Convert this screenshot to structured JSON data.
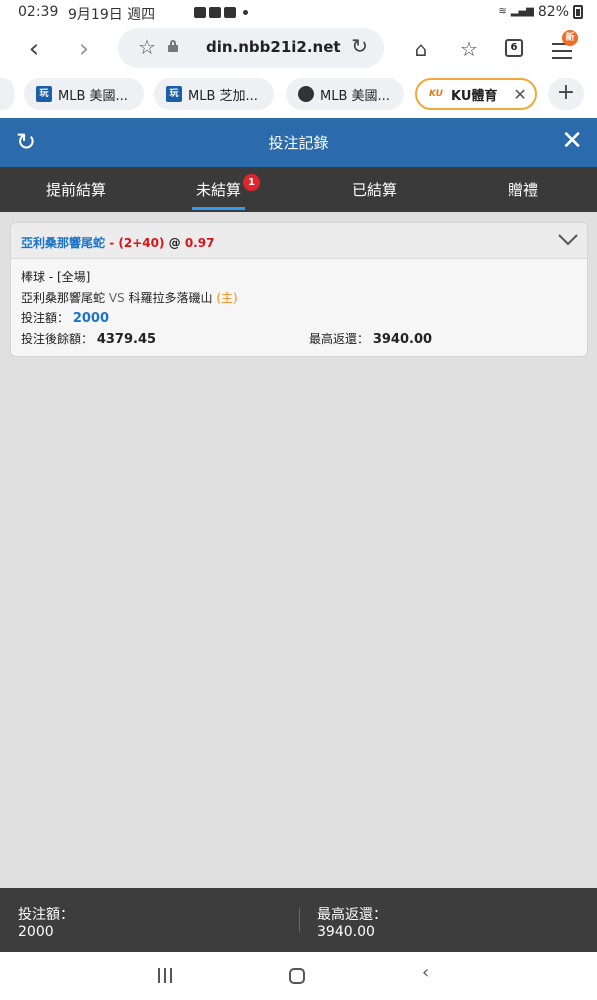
{
  "status": {
    "time": "02:39",
    "date": "9月19日 週四",
    "battery": "82%"
  },
  "browser": {
    "url": "din.nbb21i2.net",
    "tab_count": "6",
    "menu_badge": "新",
    "tabs": [
      {
        "label": "MLB 美國...",
        "icon": "sports-site-icon"
      },
      {
        "label": "MLB 芝加...",
        "icon": "sports-site-icon"
      },
      {
        "label": "MLB 美國...",
        "icon": "helmet-icon"
      },
      {
        "label": "KU體育",
        "icon": "ku-logo-icon"
      }
    ],
    "ku_badge": "KU"
  },
  "app": {
    "title": "投注記錄",
    "tabs": [
      {
        "label": "提前結算"
      },
      {
        "label": "未結算"
      },
      {
        "label": "已結算"
      },
      {
        "label": "贈禮"
      }
    ],
    "unsettled_count": "1"
  },
  "bet": {
    "team": "亞利桑那響尾蛇",
    "handicap": "- (2+40)",
    "at": "@",
    "odds": "0.97",
    "sport_line": "棒球 - [全場]",
    "home_team": "亞利桑那響尾蛇",
    "vs": "VS",
    "away_team": "科羅拉多落磯山",
    "home_tag": "(主)",
    "stake_label": "投注額：",
    "stake_value": "2000",
    "balance_label": "投注後餘額：",
    "balance_value": "4379.45",
    "max_return_label": "最高返還：",
    "max_return_value": "3940.00"
  },
  "footer": {
    "stake_label": "投注額：",
    "stake_value": "2000",
    "max_return_label": "最高返還：",
    "max_return_value": "3940.00"
  },
  "colors": {
    "header_blue": "#2b6bab",
    "tab_dark": "#3a3a3a",
    "active_underline": "#2f9cf0",
    "badge_red": "#e0262c",
    "team_blue": "#1a73c9",
    "odds_red": "#d8141b",
    "home_orange": "#f08c1a"
  }
}
